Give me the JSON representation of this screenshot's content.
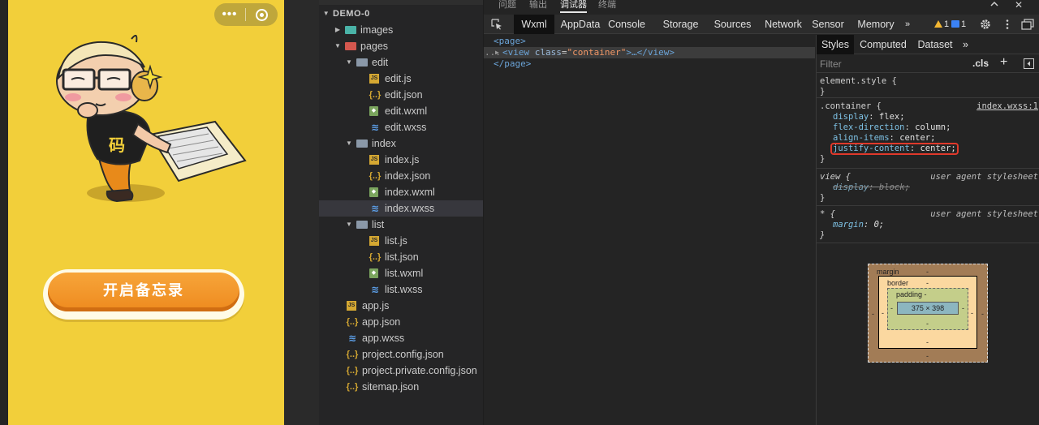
{
  "simulator": {
    "capsule_dots": "•••",
    "start_button_label": "开启备忘录",
    "mascot_badge": "码"
  },
  "file_tree": {
    "root": "DEMO-0",
    "items": [
      {
        "label": "images",
        "type": "folder-teal",
        "arrow": "▶"
      },
      {
        "label": "pages",
        "type": "folder-red",
        "arrow": "▼"
      },
      {
        "label": "edit",
        "type": "folder-grey",
        "arrow": "▼"
      },
      {
        "label": "edit.js",
        "type": "js"
      },
      {
        "label": "edit.json",
        "type": "json"
      },
      {
        "label": "edit.wxml",
        "type": "wxml"
      },
      {
        "label": "edit.wxss",
        "type": "wxss"
      },
      {
        "label": "index",
        "type": "folder-grey",
        "arrow": "▼"
      },
      {
        "label": "index.js",
        "type": "js"
      },
      {
        "label": "index.json",
        "type": "json"
      },
      {
        "label": "index.wxml",
        "type": "wxml"
      },
      {
        "label": "index.wxss",
        "type": "wxss",
        "selected": true
      },
      {
        "label": "list",
        "type": "folder-grey",
        "arrow": "▼"
      },
      {
        "label": "list.js",
        "type": "js"
      },
      {
        "label": "list.json",
        "type": "json"
      },
      {
        "label": "list.wxml",
        "type": "wxml"
      },
      {
        "label": "list.wxss",
        "type": "wxss"
      },
      {
        "label": "app.js",
        "type": "js"
      },
      {
        "label": "app.json",
        "type": "json"
      },
      {
        "label": "app.wxss",
        "type": "wxss"
      },
      {
        "label": "project.config.json",
        "type": "json"
      },
      {
        "label": "project.private.config.json",
        "type": "json"
      },
      {
        "label": "sitemap.json",
        "type": "json"
      }
    ]
  },
  "debugger": {
    "panel_tabs": [
      "问题",
      "输出",
      "调试器",
      "终端"
    ],
    "active_panel_tab": "调试器",
    "close_symbol": "✕",
    "toolbar_tabs": [
      "Wxml",
      "AppData",
      "Console",
      "Storage",
      "Sources",
      "Network",
      "Sensor",
      "Memory"
    ],
    "more_symbol": "»",
    "warning_count": "1",
    "message_count": "1"
  },
  "elements": {
    "line1_tag": "<page>",
    "line2_ellipsis": "...",
    "line2_arrow": "▶",
    "line2_open": "<view",
    "line2_attr": "class",
    "line2_eq": "=",
    "line2_val": "\"container\"",
    "line2_rest": ">…</view>",
    "line3_tag": "</page>"
  },
  "styles": {
    "tabs": [
      "Styles",
      "Computed",
      "Dataset"
    ],
    "more_symbol": "»",
    "filter_placeholder": "Filter",
    "cls_label": ".cls",
    "plus_symbol": "+",
    "rules": {
      "element_style": {
        "selector": "element.style {",
        "close": "}"
      },
      "container": {
        "selector": ".container {",
        "source": "index.wxss:1",
        "props": [
          {
            "name": "display",
            "value": "flex;"
          },
          {
            "name": "flex-direction",
            "value": "column;"
          },
          {
            "name": "align-items",
            "value": "center;"
          },
          {
            "name": "justify-content",
            "value": "center;"
          }
        ],
        "close": "}"
      },
      "view": {
        "selector": "view {",
        "source": "user agent stylesheet",
        "prop_name": "display",
        "prop_value": "block;",
        "close": "}"
      },
      "star": {
        "selector": "* {",
        "source": "user agent stylesheet",
        "prop_name": "margin",
        "prop_value": "0;",
        "close": "}"
      }
    }
  },
  "box_model": {
    "margin_label": "margin",
    "border_label": "border",
    "padding_label": "padding -",
    "content_size": "375 × 398",
    "dash": "-"
  }
}
